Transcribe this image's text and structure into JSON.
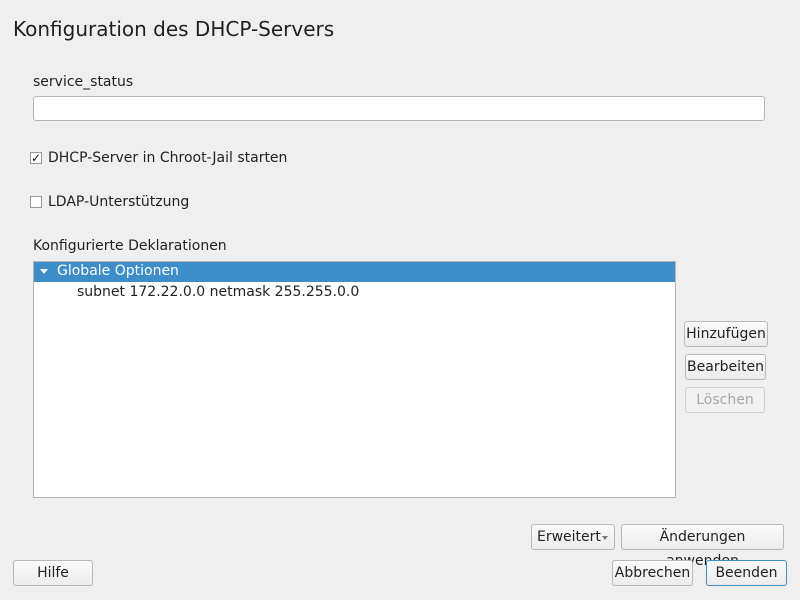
{
  "window": {
    "title": "Konfiguration des DHCP-Servers",
    "status_icon": "moon-icon"
  },
  "service_status": {
    "label": "service_status",
    "value": ""
  },
  "chroot": {
    "checked": true,
    "label": "DHCP-Server in Chroot-Jail starten",
    "check_glyph": "✓"
  },
  "ldap": {
    "checked": false,
    "label": "LDAP-Unterstützung"
  },
  "declarations": {
    "label": "Konfigurierte Deklarationen",
    "items": [
      {
        "label": "Globale Optionen",
        "expanded": true,
        "selected": true
      },
      {
        "label": "subnet 172.22.0.0 netmask 255.255.0.0",
        "selected": false
      }
    ]
  },
  "buttons": {
    "add": "Hinzufügen",
    "edit": "Bearbeiten",
    "delete": "Löschen",
    "advanced": "Erweitert",
    "apply": "Änderungen anwenden",
    "help": "Hilfe",
    "cancel": "Abbrechen",
    "finish": "Beenden"
  },
  "colors": {
    "selection": "#3c8dc8",
    "background": "#efefef"
  }
}
